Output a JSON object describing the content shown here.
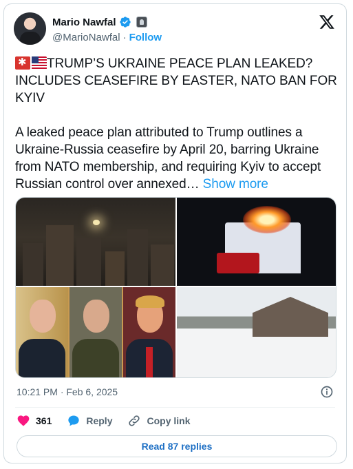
{
  "author": {
    "name": "Mario Nawfal",
    "handle": "@MarioNawfal",
    "separator": "·",
    "follow_label": "Follow"
  },
  "tweet": {
    "headline": "TRUMP’S UKRAINE PEACE PLAN LEAKED? INCLUDES CEASEFIRE BY EASTER, NATO BAN FOR KYIV",
    "text": "A leaked peace plan attributed to Trump outlines a Ukraine-Russia ceasefire by April 20, barring Ukraine from NATO membership, and requiring Kyiv to accept Russian control over annexed… ",
    "show_more_label": "Show more"
  },
  "media": [
    {
      "icon": "night-city-photo"
    },
    {
      "icon": "burning-building-photo"
    },
    {
      "icon": "three-leaders-photo"
    },
    {
      "icon": "snowy-ruins-photo"
    }
  ],
  "meta": {
    "timestamp": "10:21 PM · Feb 6, 2025"
  },
  "actions": {
    "like_count": "361",
    "reply_label": "Reply",
    "copy_link_label": "Copy link",
    "read_replies_label": "Read 87 replies"
  },
  "colors": {
    "accent": "#1d9bf0",
    "like": "#f91880",
    "muted": "#536471",
    "border": "#cfd9de"
  }
}
